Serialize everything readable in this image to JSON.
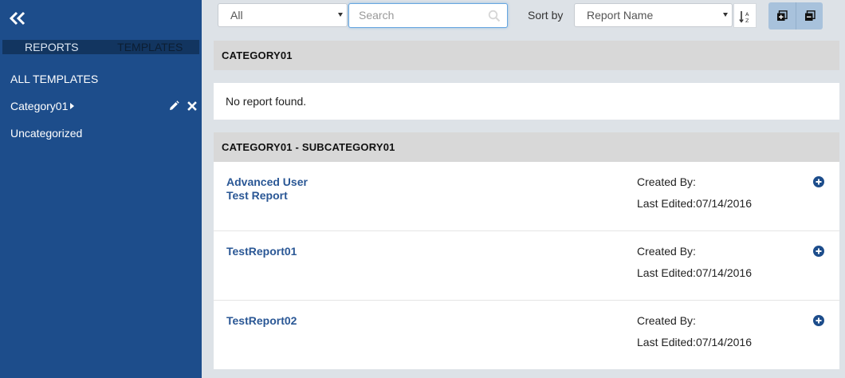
{
  "sidebar": {
    "tabs": [
      {
        "label": "REPORTS"
      },
      {
        "label": "TEMPLATES"
      }
    ],
    "items": [
      {
        "label": "ALL TEMPLATES"
      },
      {
        "label": "Category01"
      },
      {
        "label": "Uncategorized"
      }
    ],
    "icons": {
      "collapse": "double-chevron-left-icon",
      "edit": "pencil-icon",
      "delete": "close-icon"
    }
  },
  "toolbar": {
    "filter_value": "All",
    "search_placeholder": "Search",
    "sort_label": "Sort by",
    "sort_value": "Report Name",
    "icons": {
      "sort_dir": "sort-alpha-asc-icon",
      "expand": "expand-all-icon",
      "collapse": "collapse-all-icon",
      "search": "search-icon"
    }
  },
  "groups": [
    {
      "title": "CATEGORY01",
      "empty_text": "No report found."
    },
    {
      "title": "CATEGORY01 - SUBCATEGORY01",
      "reports": [
        {
          "name": "Advanced User Test Report",
          "created_by": "Created By:",
          "last_edited": "Last Edited:07/14/2016"
        },
        {
          "name": "TestReport01",
          "created_by": "Created By:",
          "last_edited": "Last Edited:07/14/2016"
        },
        {
          "name": "TestReport02",
          "created_by": "Created By:",
          "last_edited": "Last Edited:07/14/2016"
        }
      ]
    }
  ],
  "colors": {
    "sidebar": "#1d4d8b",
    "link": "#2a5795",
    "header_bg": "#d8d8d8",
    "page_bg": "#dde2e7"
  }
}
